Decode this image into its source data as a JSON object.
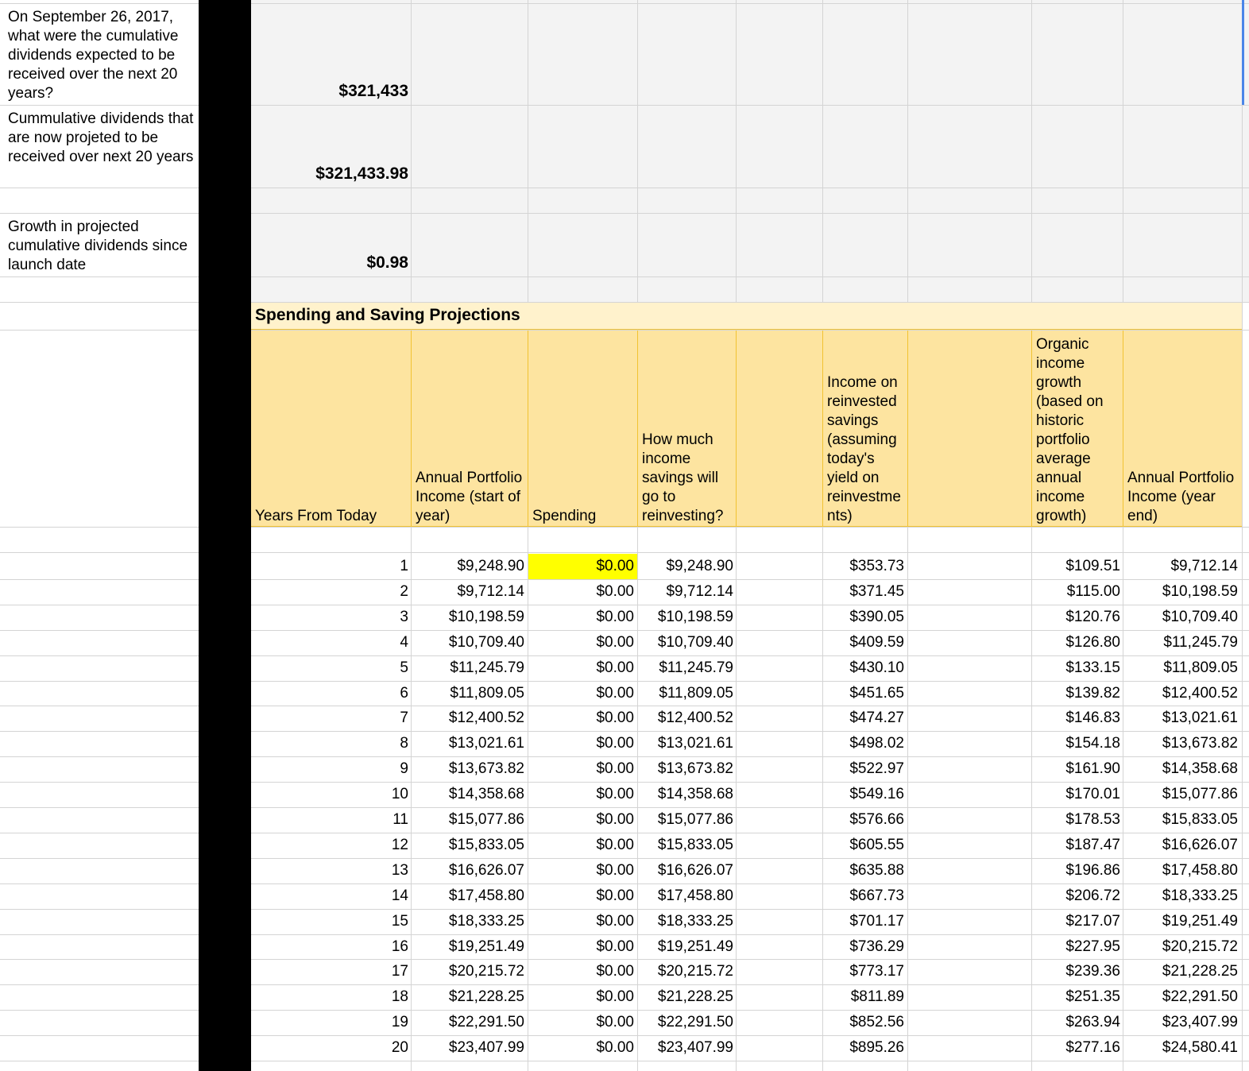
{
  "summary": [
    {
      "label": "On September 26, 2017, what were the cumulative dividends expected to be received over the next 20 years?",
      "value": "$321,433"
    },
    {
      "label": "Cummulative dividends that are now projeted to be received over next 20 years",
      "value": "$321,433.98"
    },
    {
      "label": "Growth in projected cumulative dividends since launch date",
      "value": "$0.98"
    }
  ],
  "section_title": "Spending and Saving Projections",
  "headers": {
    "years": "Years From Today",
    "start_income": "Annual Portfolio Income (start of year)",
    "spending": "Spending",
    "reinvest": "How much income savings will go to reinvesting?",
    "reinvest_income": "Income on reinvested savings (assuming today's yield on reinvestme nts)",
    "organic": "Organic income growth (based on historic portfolio average annual income growth)",
    "end_income": "Annual Portfolio Income (year end)"
  },
  "colors": {
    "header_bg": "#fde4a0",
    "title_bg": "#fff2cc",
    "highlight": "#ffff00",
    "top_bg": "#f3f3f3",
    "bar": "#000000"
  },
  "rows": [
    [
      "1",
      "$9,248.90",
      "$0.00",
      "$9,248.90",
      "$353.73",
      "$109.51",
      "$9,712.14"
    ],
    [
      "2",
      "$9,712.14",
      "$0.00",
      "$9,712.14",
      "$371.45",
      "$115.00",
      "$10,198.59"
    ],
    [
      "3",
      "$10,198.59",
      "$0.00",
      "$10,198.59",
      "$390.05",
      "$120.76",
      "$10,709.40"
    ],
    [
      "4",
      "$10,709.40",
      "$0.00",
      "$10,709.40",
      "$409.59",
      "$126.80",
      "$11,245.79"
    ],
    [
      "5",
      "$11,245.79",
      "$0.00",
      "$11,245.79",
      "$430.10",
      "$133.15",
      "$11,809.05"
    ],
    [
      "6",
      "$11,809.05",
      "$0.00",
      "$11,809.05",
      "$451.65",
      "$139.82",
      "$12,400.52"
    ],
    [
      "7",
      "$12,400.52",
      "$0.00",
      "$12,400.52",
      "$474.27",
      "$146.83",
      "$13,021.61"
    ],
    [
      "8",
      "$13,021.61",
      "$0.00",
      "$13,021.61",
      "$498.02",
      "$154.18",
      "$13,673.82"
    ],
    [
      "9",
      "$13,673.82",
      "$0.00",
      "$13,673.82",
      "$522.97",
      "$161.90",
      "$14,358.68"
    ],
    [
      "10",
      "$14,358.68",
      "$0.00",
      "$14,358.68",
      "$549.16",
      "$170.01",
      "$15,077.86"
    ],
    [
      "11",
      "$15,077.86",
      "$0.00",
      "$15,077.86",
      "$576.66",
      "$178.53",
      "$15,833.05"
    ],
    [
      "12",
      "$15,833.05",
      "$0.00",
      "$15,833.05",
      "$605.55",
      "$187.47",
      "$16,626.07"
    ],
    [
      "13",
      "$16,626.07",
      "$0.00",
      "$16,626.07",
      "$635.88",
      "$196.86",
      "$17,458.80"
    ],
    [
      "14",
      "$17,458.80",
      "$0.00",
      "$17,458.80",
      "$667.73",
      "$206.72",
      "$18,333.25"
    ],
    [
      "15",
      "$18,333.25",
      "$0.00",
      "$18,333.25",
      "$701.17",
      "$217.07",
      "$19,251.49"
    ],
    [
      "16",
      "$19,251.49",
      "$0.00",
      "$19,251.49",
      "$736.29",
      "$227.95",
      "$20,215.72"
    ],
    [
      "17",
      "$20,215.72",
      "$0.00",
      "$20,215.72",
      "$773.17",
      "$239.36",
      "$21,228.25"
    ],
    [
      "18",
      "$21,228.25",
      "$0.00",
      "$21,228.25",
      "$811.89",
      "$251.35",
      "$22,291.50"
    ],
    [
      "19",
      "$22,291.50",
      "$0.00",
      "$22,291.50",
      "$852.56",
      "$263.94",
      "$23,407.99"
    ],
    [
      "20",
      "$23,407.99",
      "$0.00",
      "$23,407.99",
      "$895.26",
      "$277.16",
      "$24,580.41"
    ]
  ]
}
